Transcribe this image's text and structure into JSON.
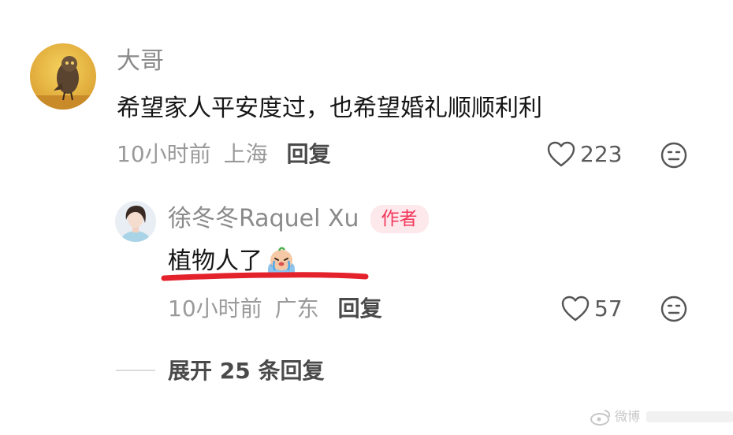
{
  "comment": {
    "author": "大哥",
    "text": "希望家人平安度过，也希望婚礼顺顺利利",
    "time": "10小时前",
    "location": "上海",
    "reply_label": "回复",
    "like_count": "223"
  },
  "reply": {
    "author": "徐冬冬Raquel Xu",
    "badge": "作者",
    "text": "植物人了",
    "time": "10小时前",
    "location": "广东",
    "reply_label": "回复",
    "like_count": "57"
  },
  "expand": {
    "label": "展开 25 条回复"
  },
  "watermark": "微博",
  "colors": {
    "badge_bg": "#fde8ec",
    "badge_text": "#f2375a",
    "underline": "#e4222c"
  }
}
